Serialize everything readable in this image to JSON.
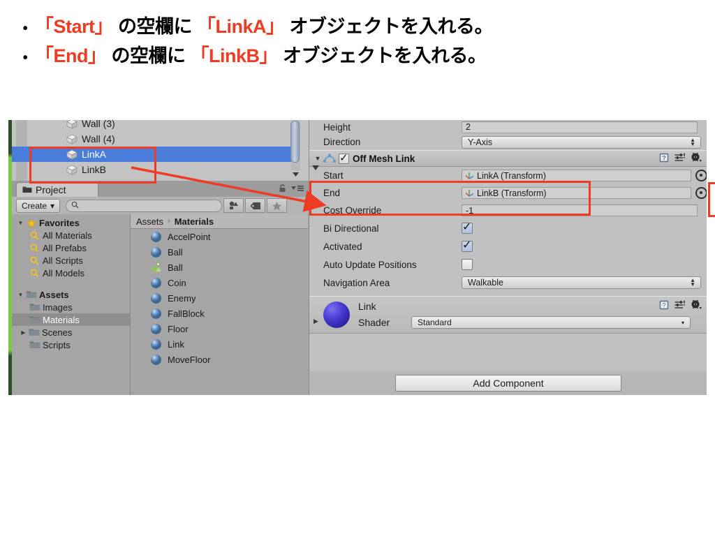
{
  "slide": {
    "bullets": [
      {
        "marker": "•",
        "segments": [
          {
            "t": "「Start」",
            "hl": true
          },
          {
            "t": " の空欄に ",
            "hl": false
          },
          {
            "t": "「LinkA」",
            "hl": true
          },
          {
            "t": " オブジェクトを入れる。",
            "hl": false
          }
        ]
      },
      {
        "marker": "•",
        "segments": [
          {
            "t": "「End」",
            "hl": true
          },
          {
            "t": " の空欄に ",
            "hl": false
          },
          {
            "t": "「LinkB」",
            "hl": true
          },
          {
            "t": " オブジェクトを入れる。",
            "hl": false
          }
        ]
      }
    ]
  },
  "hierarchy": {
    "rows": [
      {
        "label": "Wall (3)",
        "icon": "cube-icon",
        "selected": false
      },
      {
        "label": "Wall (4)",
        "icon": "cube-icon",
        "selected": false
      },
      {
        "label": "LinkA",
        "icon": "cube-icon",
        "selected": true
      },
      {
        "label": "LinkB",
        "icon": "cube-icon",
        "selected": false
      }
    ],
    "scroll_down_icon": "triangle-down-icon"
  },
  "project": {
    "tab_label": "Project",
    "tab_icon": "folder-icon",
    "lock_icon": "padlock-icon",
    "menu_icon": "hamburger-menu-icon",
    "create_label": "Create",
    "create_caret": "▾",
    "search_placeholder": "",
    "search_value": "",
    "search_icon": "magnifier-icon",
    "toolbar_icons": [
      "shapes-filter-icon",
      "label-tag-icon",
      "star-favorite-icon"
    ],
    "breadcrumb": {
      "root": "Assets",
      "separator": "›",
      "current": "Materials"
    },
    "tree": [
      {
        "label": "Favorites",
        "icon": "star-icon",
        "indent": 0,
        "twisty": "▼",
        "bold": true,
        "selected": false
      },
      {
        "label": "All Materials",
        "icon": "search-icon",
        "indent": 1,
        "twisty": "",
        "bold": false,
        "selected": false
      },
      {
        "label": "All Prefabs",
        "icon": "search-icon",
        "indent": 1,
        "twisty": "",
        "bold": false,
        "selected": false
      },
      {
        "label": "All Scripts",
        "icon": "search-icon",
        "indent": 1,
        "twisty": "",
        "bold": false,
        "selected": false
      },
      {
        "label": "All Models",
        "icon": "search-icon",
        "indent": 1,
        "twisty": "",
        "bold": false,
        "selected": false
      },
      {
        "label": "Assets",
        "icon": "folder-icon",
        "indent": 0,
        "twisty": "▼",
        "bold": true,
        "selected": false
      },
      {
        "label": "Images",
        "icon": "folder-icon",
        "indent": 1,
        "twisty": "",
        "bold": false,
        "selected": false
      },
      {
        "label": "Materials",
        "icon": "folder-icon",
        "indent": 1,
        "twisty": "",
        "bold": false,
        "selected": true
      },
      {
        "label": "Scenes",
        "icon": "folder-icon",
        "indent": 1,
        "twisty": "▶",
        "bold": false,
        "selected": false
      },
      {
        "label": "Scripts",
        "icon": "folder-icon",
        "indent": 1,
        "twisty": "",
        "bold": false,
        "selected": false
      }
    ],
    "assets": [
      {
        "label": "AccelPoint",
        "icon": "material-sphere-icon"
      },
      {
        "label": "Ball",
        "icon": "material-sphere-icon"
      },
      {
        "label": "Ball",
        "icon": "physic-material-icon"
      },
      {
        "label": "Coin",
        "icon": "material-sphere-icon"
      },
      {
        "label": "Enemy",
        "icon": "material-sphere-icon"
      },
      {
        "label": "FallBlock",
        "icon": "material-sphere-icon"
      },
      {
        "label": "Floor",
        "icon": "material-sphere-icon"
      },
      {
        "label": "Link",
        "icon": "material-sphere-icon"
      },
      {
        "label": "MoveFloor",
        "icon": "material-sphere-icon"
      }
    ]
  },
  "inspector": {
    "top_rows": [
      {
        "label": "Height",
        "value": "2",
        "kind": "field"
      },
      {
        "label": "Direction",
        "value": "Y-Axis",
        "kind": "dropdown"
      }
    ],
    "component": {
      "title": "Off Mesh Link",
      "icon": "off-mesh-link-icon",
      "enabled": true,
      "foldout": "▼",
      "help_icon": "help-book-icon",
      "preset_icon": "preset-slider-icon",
      "gear_icon": "gear-icon",
      "properties": [
        {
          "label": "Start",
          "kind": "object",
          "value": "LinkA (Transform)",
          "icon": "transform-axis-icon"
        },
        {
          "label": "End",
          "kind": "object",
          "value": "LinkB (Transform)",
          "icon": "transform-axis-icon"
        },
        {
          "label": "Cost Override",
          "kind": "field",
          "value": "-1"
        },
        {
          "label": "Bi Directional",
          "kind": "checkbox",
          "checked": true
        },
        {
          "label": "Activated",
          "kind": "checkbox",
          "checked": true
        },
        {
          "label": "Auto Update Positions",
          "kind": "checkbox",
          "checked": false
        },
        {
          "label": "Navigation Area",
          "kind": "dropdown",
          "value": "Walkable"
        }
      ]
    },
    "material": {
      "name": "Link",
      "shader_label": "Shader",
      "shader_value": "Standard",
      "foldout": "▶",
      "preview_icon": "material-sphere-preview",
      "help_icon": "help-book-icon",
      "preset_icon": "preset-slider-icon",
      "gear_icon": "gear-icon",
      "sphere_color": "#4b3fd6"
    },
    "add_component_label": "Add Component"
  },
  "annotations": {
    "color": "#ee3b24",
    "boxes": [
      "hierarchy-linka-linkb-box",
      "inspector-start-end-box",
      "inspector-right-edge-box"
    ],
    "arrow": "hierarchy-to-inspector-arrow"
  }
}
